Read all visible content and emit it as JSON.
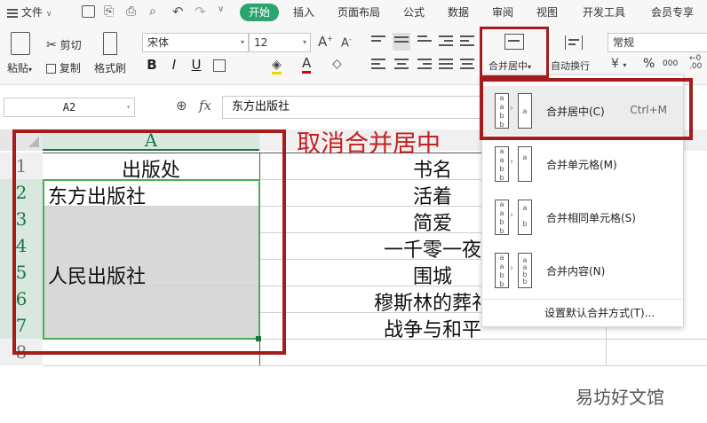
{
  "ribbon": {
    "file_menu": "文件",
    "tabs": [
      "开始",
      "插入",
      "页面布局",
      "公式",
      "数据",
      "审阅",
      "视图",
      "开发工具",
      "会员专享"
    ],
    "clipboard": {
      "paste": "粘贴",
      "cut": "剪切",
      "copy": "复制",
      "format_painter": "格式刷"
    },
    "font_name": "宋体",
    "font_size": "12",
    "merge_center_label": "合并居中",
    "wrap_text_label": "自动换行",
    "number_format": "常规",
    "percent": "%",
    "comma": "000"
  },
  "formula_bar": {
    "name_box": "A2",
    "fx": "fx",
    "content": "东方出版社"
  },
  "sheet": {
    "column_a": "A",
    "row_numbers": [
      "1",
      "2",
      "3",
      "4",
      "5",
      "6",
      "7",
      "8"
    ],
    "column_a_cells": [
      "出版处",
      "东方出版社",
      "",
      "",
      "人民出版社",
      "",
      ""
    ],
    "column_b_cells": [
      "书名",
      "活着",
      "简爱",
      "一千零一夜",
      "围城",
      "穆斯林的葬礼",
      "战争与和平"
    ]
  },
  "annotation": "取消合并居中",
  "merge_menu": {
    "items": [
      {
        "label": "合并居中(C)",
        "shortcut": "Ctrl+M"
      },
      {
        "label": "合并单元格(M)",
        "shortcut": ""
      },
      {
        "label": "合并相同单元格(S)",
        "shortcut": ""
      },
      {
        "label": "合并内容(N)",
        "shortcut": ""
      }
    ],
    "footer": "设置默认合并方式(T)..."
  },
  "watermark": "易坊好文馆",
  "colors": {
    "accent": "#2aa56f",
    "annotation_red": "#a51c1c",
    "selection_green": "#217346"
  }
}
